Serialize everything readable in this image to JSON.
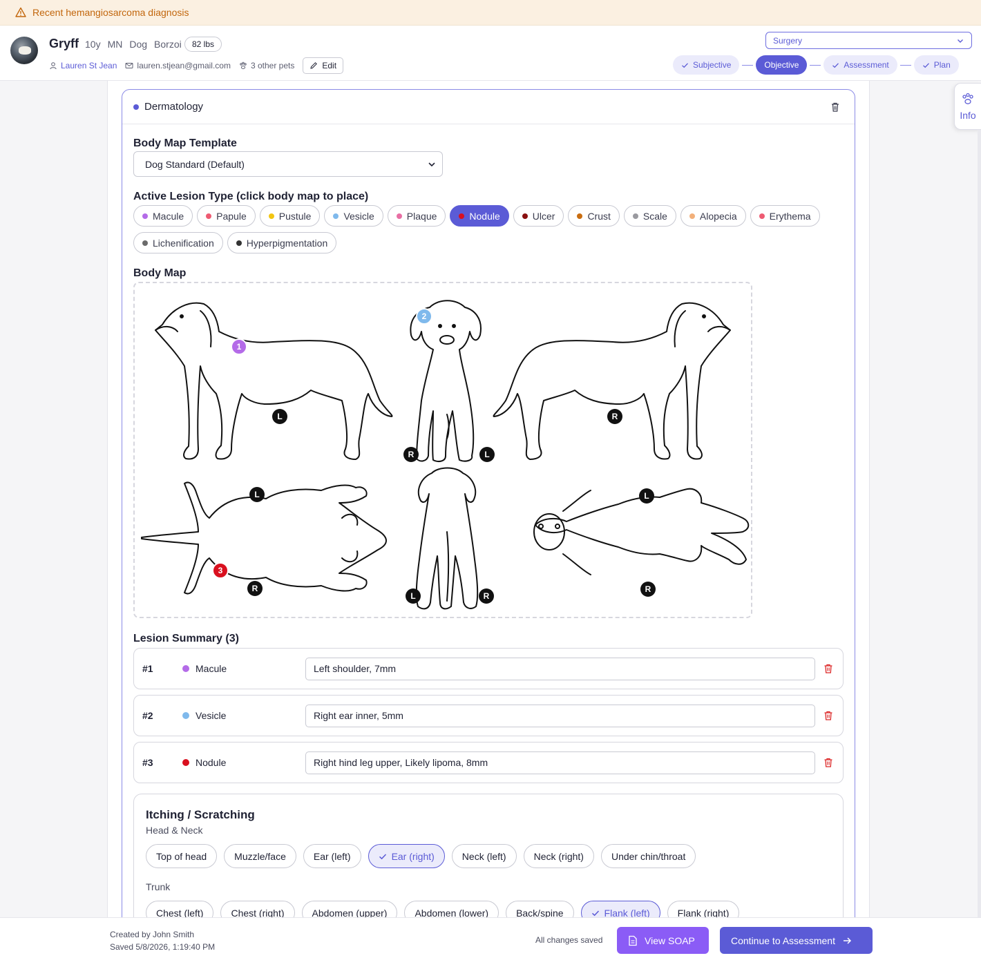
{
  "alert": {
    "text": "Recent hemangiosarcoma diagnosis"
  },
  "patient": {
    "name": "Gryff",
    "age": "10y",
    "sex": "MN",
    "species": "Dog",
    "breed": "Borzoi",
    "weight": "82 lbs",
    "owner": "Lauren St Jean",
    "email": "lauren.stjean@gmail.com",
    "other_pets": "3 other pets",
    "edit_label": "Edit"
  },
  "department": {
    "selected": "Surgery"
  },
  "steps": [
    {
      "label": "Subjective",
      "done": true
    },
    {
      "label": "Objective",
      "active": true
    },
    {
      "label": "Assessment",
      "done": true
    },
    {
      "label": "Plan",
      "done": true
    }
  ],
  "info_tab": {
    "label": "Info"
  },
  "section": {
    "title": "Dermatology",
    "template_label": "Body Map Template",
    "template_value": "Dog Standard (Default)",
    "lesion_type_label": "Active Lesion Type (click body map to place)",
    "lesion_types": [
      {
        "label": "Macule",
        "color": "#b46be8"
      },
      {
        "label": "Papule",
        "color": "#ee5b72"
      },
      {
        "label": "Pustule",
        "color": "#f2c511"
      },
      {
        "label": "Vesicle",
        "color": "#7fb9ec"
      },
      {
        "label": "Plaque",
        "color": "#e86fa4"
      },
      {
        "label": "Nodule",
        "color": "#d9101f",
        "active": true
      },
      {
        "label": "Ulcer",
        "color": "#8a1010"
      },
      {
        "label": "Crust",
        "color": "#c96d10"
      },
      {
        "label": "Scale",
        "color": "#9a9aa0"
      },
      {
        "label": "Alopecia",
        "color": "#f2b07a"
      },
      {
        "label": "Erythema",
        "color": "#ee5b72"
      },
      {
        "label": "Lichenification",
        "color": "#6b6b6b"
      },
      {
        "label": "Hyperpigmentation",
        "color": "#333333"
      }
    ],
    "body_map_label": "Body Map",
    "body_map_markers": {
      "left": "L",
      "right": "R"
    },
    "lesion_summary_label": "Lesion Summary (3)",
    "lesions": [
      {
        "num": "#1",
        "type": "Macule",
        "color": "#b46be8",
        "note": "Left shoulder, 7mm"
      },
      {
        "num": "#2",
        "type": "Vesicle",
        "color": "#7fb9ec",
        "note": "Right ear inner, 5mm"
      },
      {
        "num": "#3",
        "type": "Nodule",
        "color": "#d9101f",
        "note": "Right hind leg upper, Likely lipoma, 8mm"
      }
    ],
    "lesion_pins": [
      "1",
      "2",
      "3"
    ],
    "itching": {
      "title": "Itching / Scratching",
      "groups": [
        {
          "name": "Head & Neck",
          "items": [
            {
              "label": "Top of head"
            },
            {
              "label": "Muzzle/face"
            },
            {
              "label": "Ear (left)"
            },
            {
              "label": "Ear (right)",
              "on": true
            },
            {
              "label": "Neck (left)"
            },
            {
              "label": "Neck (right)"
            },
            {
              "label": "Under chin/throat"
            }
          ]
        },
        {
          "name": "Trunk",
          "items": [
            {
              "label": "Chest (left)"
            },
            {
              "label": "Chest (right)"
            },
            {
              "label": "Abdomen (upper)"
            },
            {
              "label": "Abdomen (lower)"
            },
            {
              "label": "Back/spine"
            },
            {
              "label": "Flank (left)",
              "on": true
            },
            {
              "label": "Flank (right)"
            }
          ]
        }
      ]
    }
  },
  "footer": {
    "created": "Created by John Smith",
    "saved": "Saved 5/8/2026, 1:19:40 PM",
    "status": "All changes saved",
    "view_soap": "View SOAP",
    "continue": "Continue to Assessment"
  },
  "colors": {
    "accent": "#5b5bd6",
    "soap_button": "#8b5cf6",
    "alert_text": "#c2660c",
    "alert_bg": "#fbf0e1"
  }
}
